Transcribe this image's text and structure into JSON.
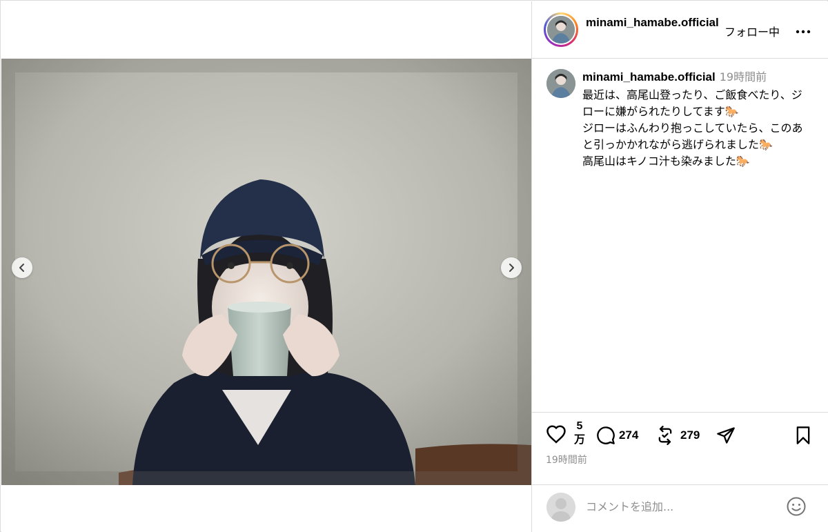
{
  "post": {
    "username": "minami_hamabe.official",
    "follow_label": "フォロー中",
    "more_label": "•••",
    "caption": {
      "username": "minami_hamabe.official",
      "time": "19時間前",
      "text": "最近は、高尾山登ったり、ご飯食べたり、ジローに嫌がられたりしてます🐎\nジローはふんわり抱っこしていたら、このあと引っかかれながら逃げられました🐎\n高尾山はキノコ汁も染みました🐎"
    },
    "actions": {
      "like_count": "5万",
      "comment_count": "274",
      "repost_count": "279"
    },
    "timestamp": "19時間前",
    "comment_placeholder": "コメントを追加..."
  },
  "carousel": {
    "prev_icon": "chevron-left-icon",
    "next_icon": "chevron-right-icon"
  },
  "colors": {
    "border": "#dbdbdb",
    "muted": "#8e8e8e",
    "story_ring": "instagram-gradient"
  }
}
